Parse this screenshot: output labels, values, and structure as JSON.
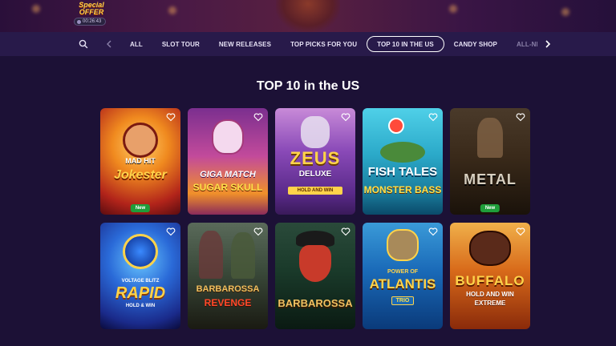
{
  "offer": {
    "label_line1": "Special",
    "label_line2": "OFFER",
    "timer": "00:26:43"
  },
  "nav": {
    "tabs": [
      {
        "label": "ALL",
        "active": false
      },
      {
        "label": "SLOT TOUR",
        "active": false
      },
      {
        "label": "NEW RELEASES",
        "active": false
      },
      {
        "label": "TOP PICKS FOR YOU",
        "active": false
      },
      {
        "label": "TOP 10 IN THE US",
        "active": true
      },
      {
        "label": "CANDY SHOP",
        "active": false
      },
      {
        "label": "ALL-NEW PROV",
        "active": false
      }
    ]
  },
  "section": {
    "title": "TOP 10 in the US"
  },
  "games": [
    {
      "line1": "MAD HIT",
      "line2": "Jokester",
      "badge": "New"
    },
    {
      "line1": "GIGA MATCH",
      "line2": "SUGAR SKULL",
      "badge": ""
    },
    {
      "line1": "ZEUS",
      "line2": "DELUXE",
      "line3": "HOLD AND WIN",
      "badge": ""
    },
    {
      "line1": "FISH TALES",
      "line2": "MONSTER BASS",
      "badge": ""
    },
    {
      "line1": "METAL",
      "line2": "",
      "badge": "New"
    },
    {
      "line1": "VOLTAGE BLITZ",
      "line2": "RAPID",
      "line3": "HOLD & WIN",
      "badge": ""
    },
    {
      "line1": "BARBAROSSA",
      "line2": "REVENGE",
      "badge": ""
    },
    {
      "line1": "BARBAROSSA",
      "line2": "",
      "badge": ""
    },
    {
      "line1": "POWER OF",
      "line2": "ATLANTIS",
      "line3": "TRIO",
      "badge": ""
    },
    {
      "line1": "BUFFALO",
      "line2": "HOLD AND WIN",
      "line3": "EXTREME",
      "badge": ""
    }
  ]
}
